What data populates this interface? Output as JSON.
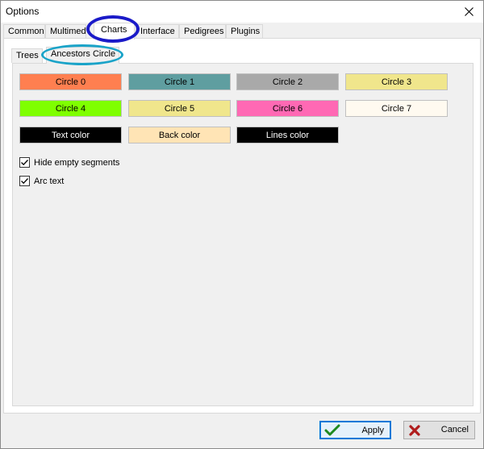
{
  "window": {
    "title": "Options"
  },
  "outer_tabs": [
    {
      "label": "Common"
    },
    {
      "label": "Multimedia"
    },
    {
      "label": "Charts"
    },
    {
      "label": "Interface"
    },
    {
      "label": "Pedigrees"
    },
    {
      "label": "Plugins"
    }
  ],
  "inner_tabs": [
    {
      "label": "Trees"
    },
    {
      "label": "Ancestors Circle"
    }
  ],
  "colors": {
    "circle0": {
      "label": "Circle 0",
      "color": "#ff7f50"
    },
    "circle1": {
      "label": "Circle 1",
      "color": "#5f9ea0"
    },
    "circle2": {
      "label": "Circle 2",
      "color": "#a9a9a9"
    },
    "circle3": {
      "label": "Circle 3",
      "color": "#f0e68c"
    },
    "circle4": {
      "label": "Circle 4",
      "color": "#7fff00"
    },
    "circle5": {
      "label": "Circle 5",
      "color": "#f0e68c"
    },
    "circle6": {
      "label": "Circle 6",
      "color": "#ff69b4"
    },
    "circle7": {
      "label": "Circle 7",
      "color": "#fffaf0"
    },
    "text_color": {
      "label": "Text color",
      "color": "#000000"
    },
    "back_color": {
      "label": "Back color",
      "color": "#ffe4b5"
    },
    "lines_color": {
      "label": "Lines color",
      "color": "#000000"
    }
  },
  "options": {
    "hide_empty_segments": {
      "label": "Hide empty segments",
      "checked": true
    },
    "arc_text": {
      "label": "Arc text",
      "checked": true
    }
  },
  "buttons": {
    "apply": "Apply",
    "cancel": "Cancel"
  },
  "annotations": {
    "charts_tab_highlight_color": "#1a1ac8",
    "ancestors_tab_highlight_color": "#1aa3c8"
  }
}
